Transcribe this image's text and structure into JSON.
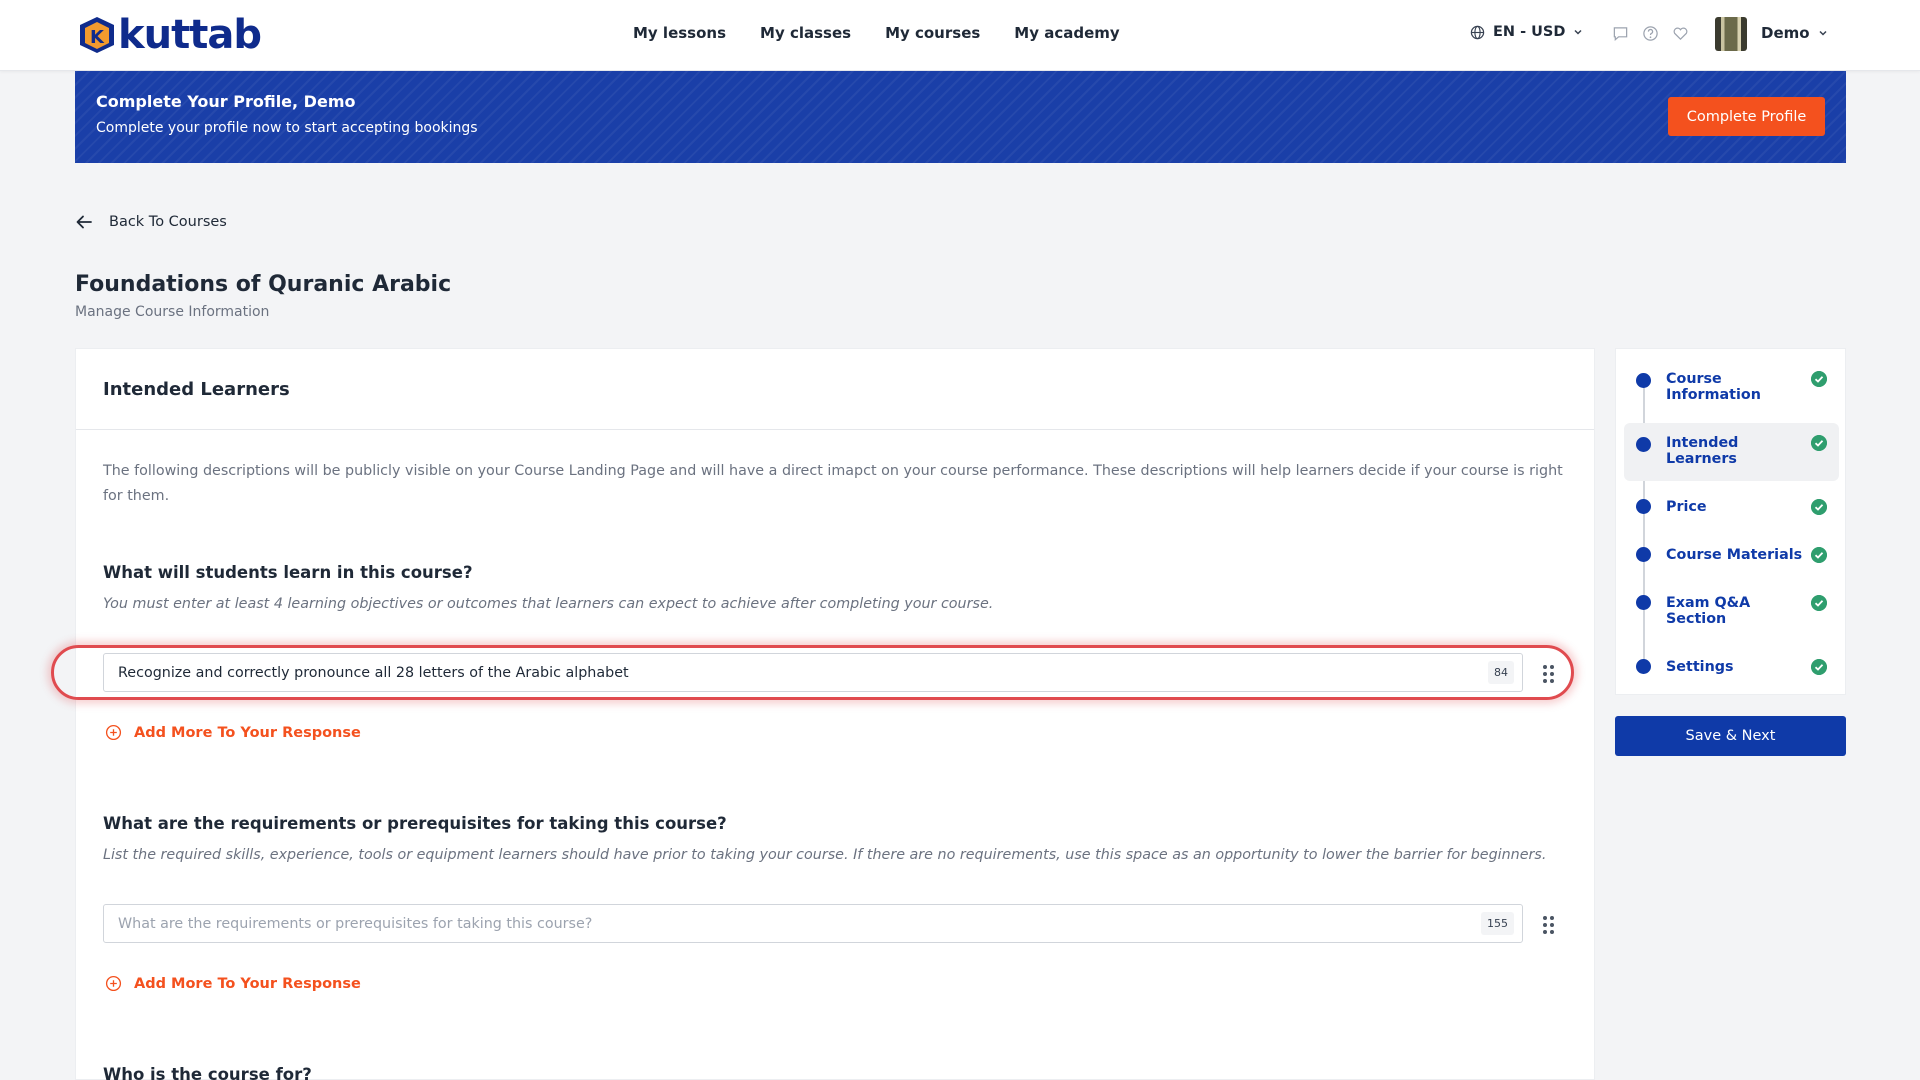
{
  "brand": {
    "name": "kuttab",
    "color": "#0f2b8c",
    "mark_letter": "K"
  },
  "nav": {
    "items": [
      "My lessons",
      "My classes",
      "My courses",
      "My academy"
    ]
  },
  "topbar": {
    "lang_currency": "EN - USD",
    "user_name": "Demo",
    "icons": [
      "globe-icon",
      "chat-icon",
      "help-icon",
      "heart-icon"
    ]
  },
  "banner": {
    "title": "Complete Your Profile, Demo",
    "subtitle": "Complete your profile now to start accepting bookings",
    "button": "Complete Profile",
    "color": "#1a3fa8",
    "button_color": "#f4511e"
  },
  "back": {
    "label": "Back To Courses"
  },
  "page": {
    "title": "Foundations of Quranic Arabic",
    "subtitle": "Manage Course Information"
  },
  "section": {
    "title": "Intended Learners",
    "description": "The following descriptions will be publicly visible on your Course Landing Page and will have a direct imapct on your course performance. These descriptions will help learners decide if your course is right for them."
  },
  "questions": [
    {
      "title": "What will students learn in this course?",
      "hint": "You must enter at least 4 learning objectives or outcomes that learners can expect to achieve after completing your course.",
      "value": "Recognize and correctly pronounce all 28 letters of the Arabic alphabet",
      "placeholder": "",
      "counter": "84",
      "add_more": "Add More To Your Response"
    },
    {
      "title": "What are the requirements or prerequisites for taking this course?",
      "hint": "List the required skills, experience, tools or equipment learners should have prior to taking your course. If there are no requirements, use this space as an opportunity to lower the barrier for beginners.",
      "value": "",
      "placeholder": "What are the requirements or prerequisites for taking this course?",
      "counter": "155",
      "add_more": "Add More To Your Response"
    },
    {
      "title": "Who is the course for?"
    }
  ],
  "steps": [
    {
      "label": "Course Information",
      "done": true
    },
    {
      "label": "Intended Learners",
      "done": true,
      "active": true
    },
    {
      "label": "Price",
      "done": true
    },
    {
      "label": "Course Materials",
      "done": true
    },
    {
      "label": "Exam Q&A Section",
      "done": true
    },
    {
      "label": "Settings",
      "done": true
    }
  ],
  "save_button": "Save & Next",
  "colors": {
    "accent": "#f4511e",
    "primary": "#0f3aa8",
    "success": "#2f9e6e",
    "highlight": "#e04b4f"
  }
}
